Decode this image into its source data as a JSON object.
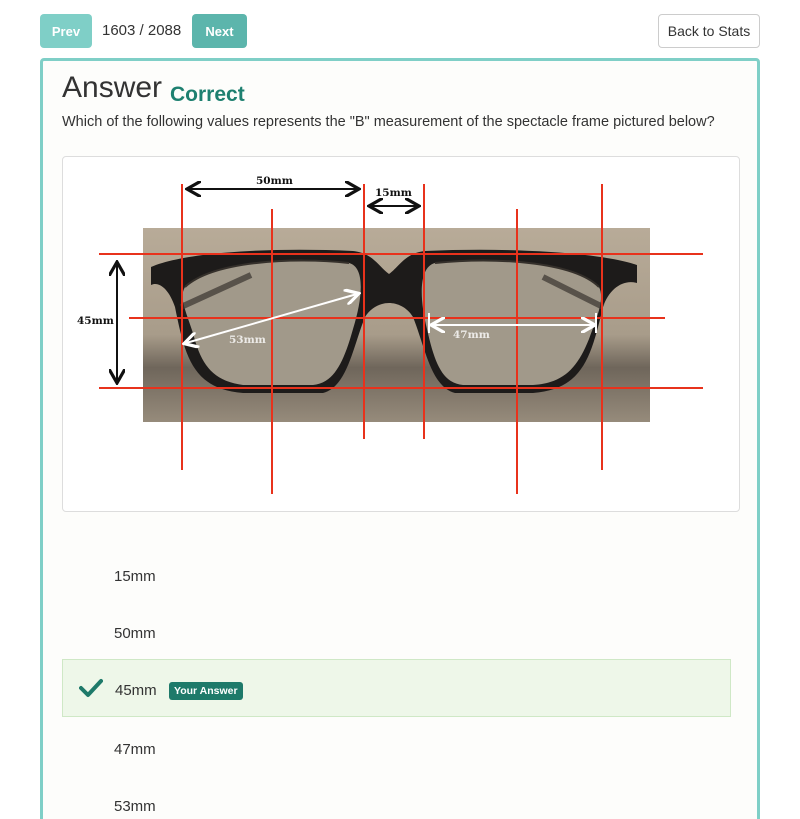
{
  "nav": {
    "prev_label": "Prev",
    "counter": "1603 / 2088",
    "next_label": "Next",
    "back_label": "Back to Stats"
  },
  "answer": {
    "title": "Answer",
    "status": "Correct",
    "status_color": "#1e8070",
    "question": "Which of the following values represents the \"B\" measurement of the spectacle frame pictured below?"
  },
  "figure": {
    "labels": {
      "a_measure": "50mm",
      "dbl_measure": "15mm",
      "b_measure": "45mm",
      "ed_measure": "53mm",
      "right_a_measure": "47mm"
    },
    "line_color": "#e8321c"
  },
  "options": [
    {
      "label": "15mm"
    },
    {
      "label": "50mm"
    },
    {
      "label": "45mm",
      "selected": true,
      "badge": "Your Answer"
    },
    {
      "label": "47mm"
    },
    {
      "label": "53mm"
    }
  ],
  "colors": {
    "accent": "#7fcfc7",
    "selected_bg": "#eef7e9",
    "badge_bg": "#1e7a6a"
  }
}
